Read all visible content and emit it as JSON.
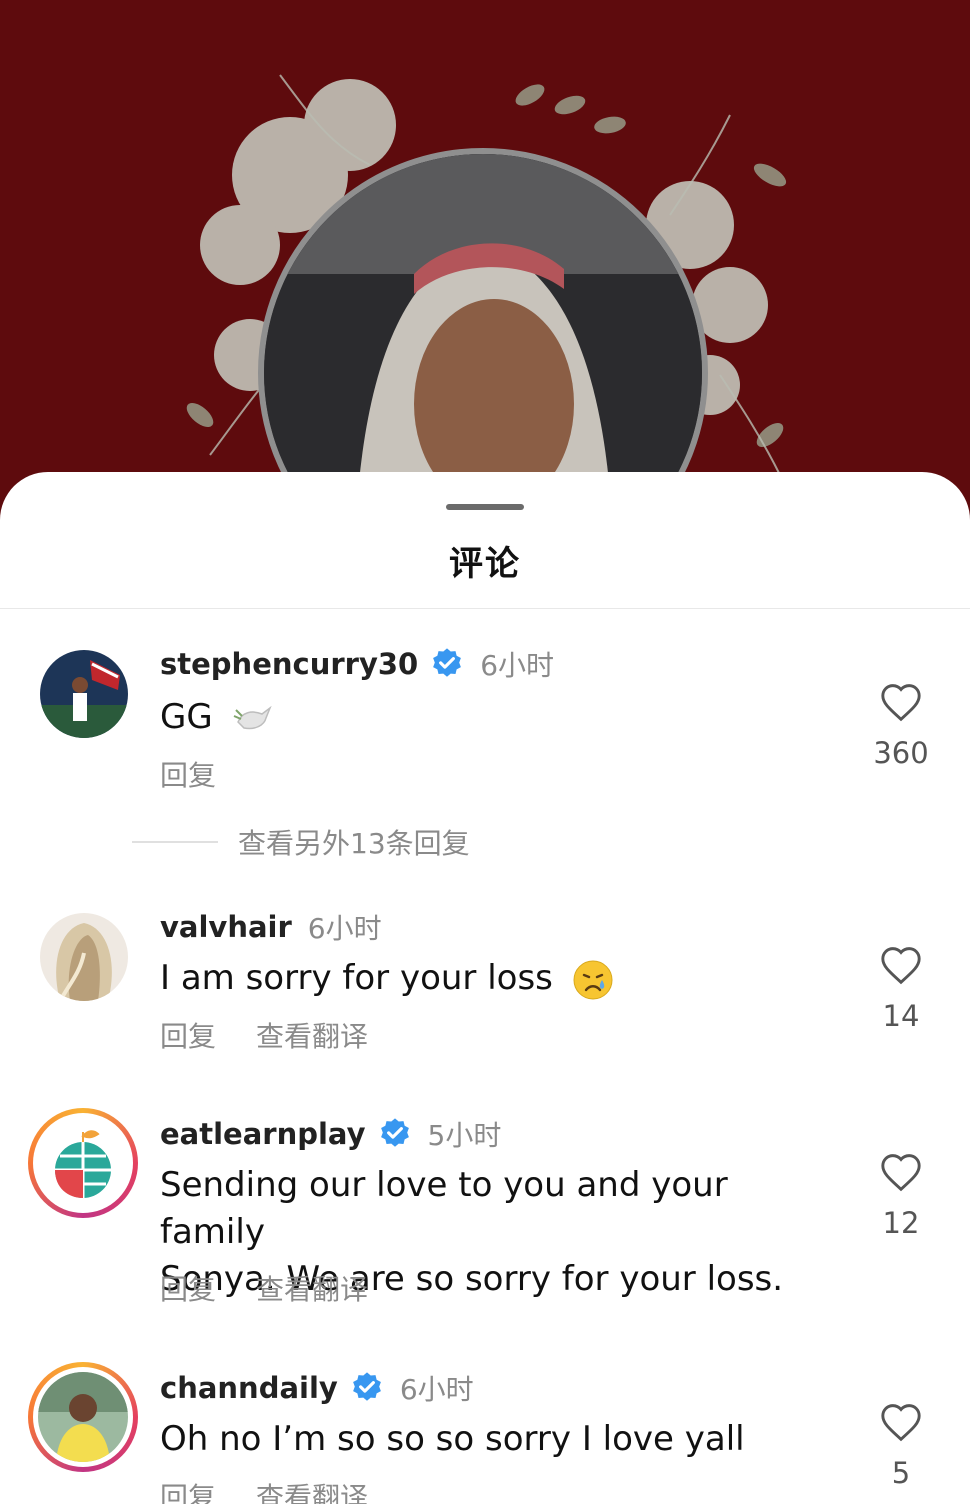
{
  "sheet": {
    "title": "评论"
  },
  "comments": [
    {
      "username": "stephencurry30",
      "verified": true,
      "time": "6小时",
      "text": "GG",
      "emoji": "dove",
      "reply": "回复",
      "likes": "360",
      "more_replies": "查看另外13条回复"
    },
    {
      "username": "valvhair",
      "verified": false,
      "time": "6小时",
      "text": "I am sorry for your loss",
      "emoji": "crying-face",
      "reply": "回复",
      "translate": "查看翻译",
      "likes": "14"
    },
    {
      "username": "eatlearnplay",
      "verified": true,
      "time": "5小时",
      "text_line1": "Sending our love to you and your family",
      "text_line2": "Sonya. We are so sorry for your loss.",
      "reply": "回复",
      "translate": "查看翻译",
      "likes": "12"
    },
    {
      "username": "channdaily",
      "verified": true,
      "time": "6小时",
      "text": "Oh no I’m so so so sorry I love yall",
      "reply": "回复",
      "translate": "查看翻译",
      "likes": "5"
    }
  ],
  "colors": {
    "background": "#5e0b0d",
    "verified_blue": "#3897f0",
    "muted": "#8a8a8a"
  }
}
